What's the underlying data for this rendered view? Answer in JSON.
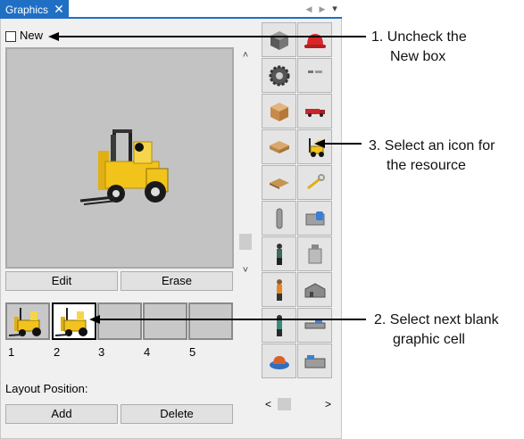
{
  "tab": {
    "title": "Graphics",
    "close": "✕"
  },
  "nav": {
    "prev": "◀",
    "next": "▶",
    "menu": "▾"
  },
  "new_checkbox": {
    "label": "New",
    "checked": false
  },
  "preview": {
    "edit_label": "Edit",
    "erase_label": "Erase"
  },
  "scroll": {
    "up": "˄",
    "down": "˅",
    "left": "<",
    "right": ">"
  },
  "cells": {
    "numbers": [
      "1",
      "2",
      "3",
      "4",
      "5"
    ]
  },
  "layout": {
    "label": "Layout Position:",
    "add_label": "Add",
    "delete_label": "Delete"
  },
  "annotations": {
    "step1_line1": "1. Uncheck the",
    "step1_line2": "New box",
    "step2_line1": "2. Select next blank",
    "step2_line2": "graphic cell",
    "step3_line1": "3. Select an icon for",
    "step3_line2": "the resource"
  },
  "icons": [
    "cube-icon",
    "hardhat-icon",
    "gear-icon",
    "clamp-icon",
    "box-icon",
    "truck-icon",
    "pallet-stack-icon",
    "forklift-icon",
    "pallet-icon",
    "wrench-icon",
    "pipe-icon",
    "machine-icon",
    "worker-icon",
    "tank-icon",
    "worker-orange-icon",
    "building-icon",
    "woman-icon",
    "conveyor-icon",
    "hardhat-blue-icon",
    "lathe-icon"
  ],
  "colors": {
    "tab_blue": "#1f6fc4",
    "forklift_yellow": "#f2c31b",
    "panel_bg": "#f0f0f0"
  }
}
